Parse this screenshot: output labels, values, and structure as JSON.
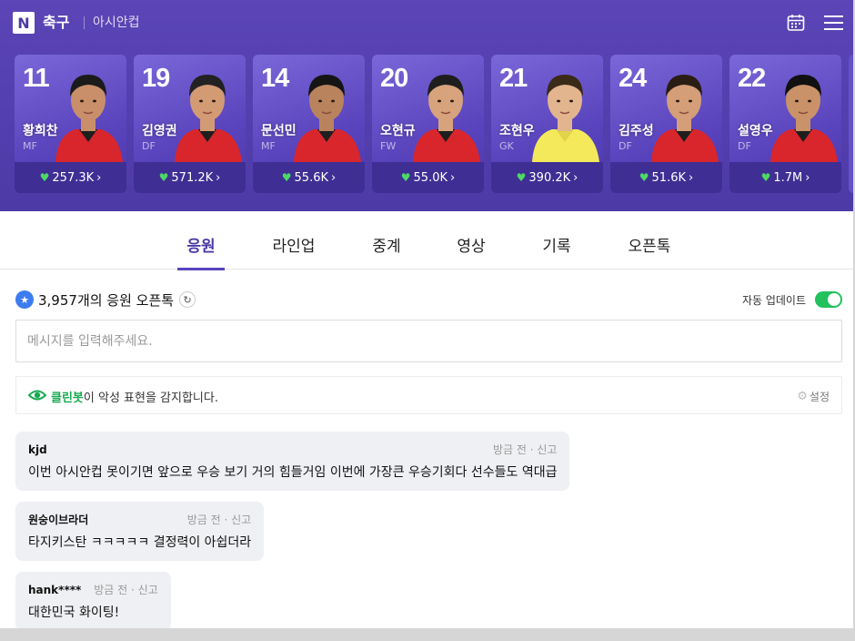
{
  "header": {
    "logo": "N",
    "sport": "축구",
    "competition": "아시안컵"
  },
  "players": [
    {
      "number": "11",
      "name": "황희찬",
      "position": "MF",
      "likes": "257.3K"
    },
    {
      "number": "19",
      "name": "김영권",
      "position": "DF",
      "likes": "571.2K"
    },
    {
      "number": "14",
      "name": "문선민",
      "position": "MF",
      "likes": "55.6K"
    },
    {
      "number": "20",
      "name": "오현규",
      "position": "FW",
      "likes": "55.0K"
    },
    {
      "number": "21",
      "name": "조현우",
      "position": "GK",
      "likes": "390.2K"
    },
    {
      "number": "24",
      "name": "김주성",
      "position": "DF",
      "likes": "51.6K"
    },
    {
      "number": "22",
      "name": "설영우",
      "position": "DF",
      "likes": "1.7M"
    }
  ],
  "tabs": [
    "응원",
    "라인업",
    "중계",
    "영상",
    "기록",
    "오픈톡"
  ],
  "active_tab": "응원",
  "talk": {
    "count_label": "3,957개의 응원 오픈톡",
    "auto_update_label": "자동 업데이트",
    "auto_update_on": true,
    "input_placeholder": "메시지를 입력해주세요.",
    "cleanbot_name": "클린봇",
    "cleanbot_text": "이 악성 표현을 감지합니다.",
    "settings_label": "설정"
  },
  "messages": [
    {
      "user": "kjd",
      "time": "방금 전",
      "report": "신고",
      "text": "이번 아시안컵 못이기면 앞으로 우승 보기 거의 힘들거임 이번에 가장큰 우승기회다 선수들도 역대급"
    },
    {
      "user": "원숭이브라더",
      "time": "방금 전",
      "report": "신고",
      "text": "타지키스탄 ㅋㅋㅋㅋㅋ 결정력이 아쉽더라"
    },
    {
      "user": "hank****",
      "time": "방금 전",
      "report": "신고",
      "text": "대한민국 화이팅!"
    }
  ],
  "colors": {
    "brand": "#4d3aa6",
    "heart": "#4cd964",
    "toggle_on": "#22c15e",
    "cleanbot": "#1aaa52",
    "star_badge": "#3d7cf0"
  }
}
